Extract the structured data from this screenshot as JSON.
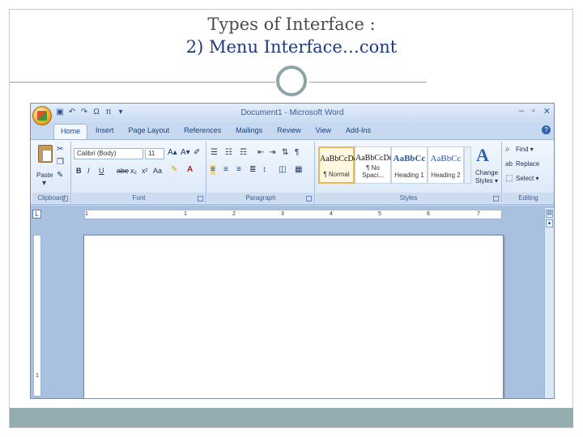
{
  "slide": {
    "title_line1": "Types of Interface :",
    "title_line2": "2) Menu Interface…cont"
  },
  "window": {
    "title": "Document1 - Microsoft Word",
    "controls": [
      "–",
      "▫",
      "✕"
    ],
    "help": "?"
  },
  "qat": [
    "save-icon",
    "undo-icon",
    "redo-icon",
    "omega-icon",
    "pi-icon",
    "customize-icon"
  ],
  "tabs": [
    {
      "label": "Home",
      "active": true
    },
    {
      "label": "Insert"
    },
    {
      "label": "Page Layout"
    },
    {
      "label": "References"
    },
    {
      "label": "Mailings"
    },
    {
      "label": "Review"
    },
    {
      "label": "View"
    },
    {
      "label": "Add-Ins"
    }
  ],
  "ribbon": {
    "clipboard": {
      "label": "Clipboard",
      "paste": "Paste"
    },
    "font": {
      "label": "Font",
      "font_name": "Calibri (Body)",
      "font_size": "11",
      "row2": [
        "B",
        "I",
        "U",
        "abe",
        "x₂",
        "x²",
        "Aa"
      ]
    },
    "paragraph": {
      "label": "Paragraph",
      "pilcrow": "¶"
    },
    "styles": {
      "label": "Styles",
      "items": [
        {
          "sample": "AaBbCcDc",
          "name": "¶ Normal",
          "selected": true,
          "heading": false
        },
        {
          "sample": "AaBbCcDc",
          "name": "¶ No Spaci...",
          "selected": false,
          "heading": false
        },
        {
          "sample": "AaBbCc",
          "name": "Heading 1",
          "selected": false,
          "heading": true
        },
        {
          "sample": "AaBbCc",
          "name": "Heading 2",
          "selected": false,
          "heading": true
        }
      ],
      "change_styles_line1": "Change",
      "change_styles_line2": "Styles ▾"
    },
    "editing": {
      "label": "Editing",
      "find": "Find ▾",
      "replace": "Replace",
      "select": "Select ▾"
    }
  },
  "ruler": {
    "corner": "L",
    "marks": [
      "1",
      "1",
      "2",
      "3",
      "4",
      "5",
      "6",
      "7"
    ]
  },
  "vruler_marks": [
    "1"
  ]
}
